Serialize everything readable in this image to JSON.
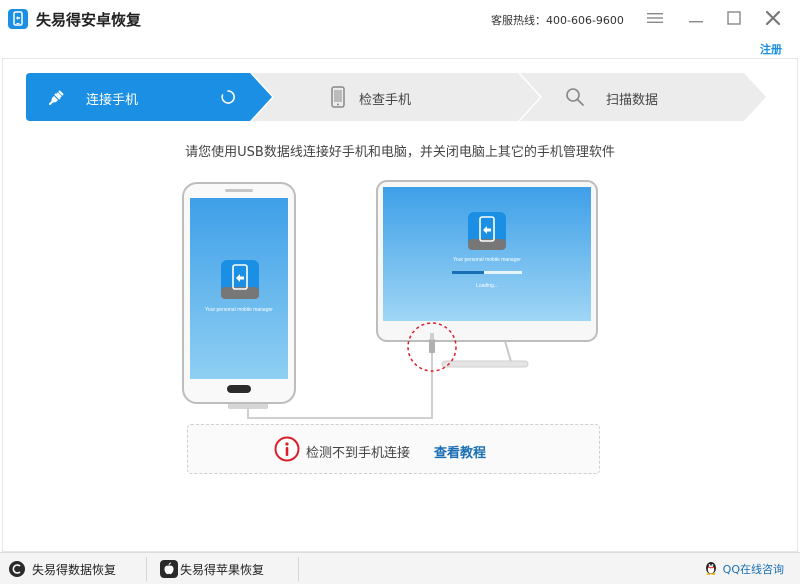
{
  "window": {
    "title": "失易得安卓恢复",
    "hotline": "客服热线：400-606-9600",
    "register_label": "注册"
  },
  "steps": [
    {
      "label": "连接手机",
      "state": "active"
    },
    {
      "label": "检查手机",
      "state": "inactive"
    },
    {
      "label": "扫描数据",
      "state": "inactive"
    }
  ],
  "instruction": "请您使用USB数据线连接好手机和电脑，并关闭电脑上其它的手机管理软件",
  "illustration": {
    "phone_caption": "Your personal mobile manager",
    "monitor_caption": "Your personal mobile manager",
    "monitor_loading": "Loading..."
  },
  "status": {
    "message": "检测不到手机连接",
    "link_label": "查看教程"
  },
  "bottom": {
    "tab1_label": "失易得数据恢复",
    "tab2_label": "失易得苹果恢复",
    "qq_label": "QQ在线咨询"
  },
  "colors": {
    "accent": "#1a8fe3",
    "step_inactive": "#ececec",
    "error": "#d9202a",
    "link": "#1a6fb5"
  }
}
